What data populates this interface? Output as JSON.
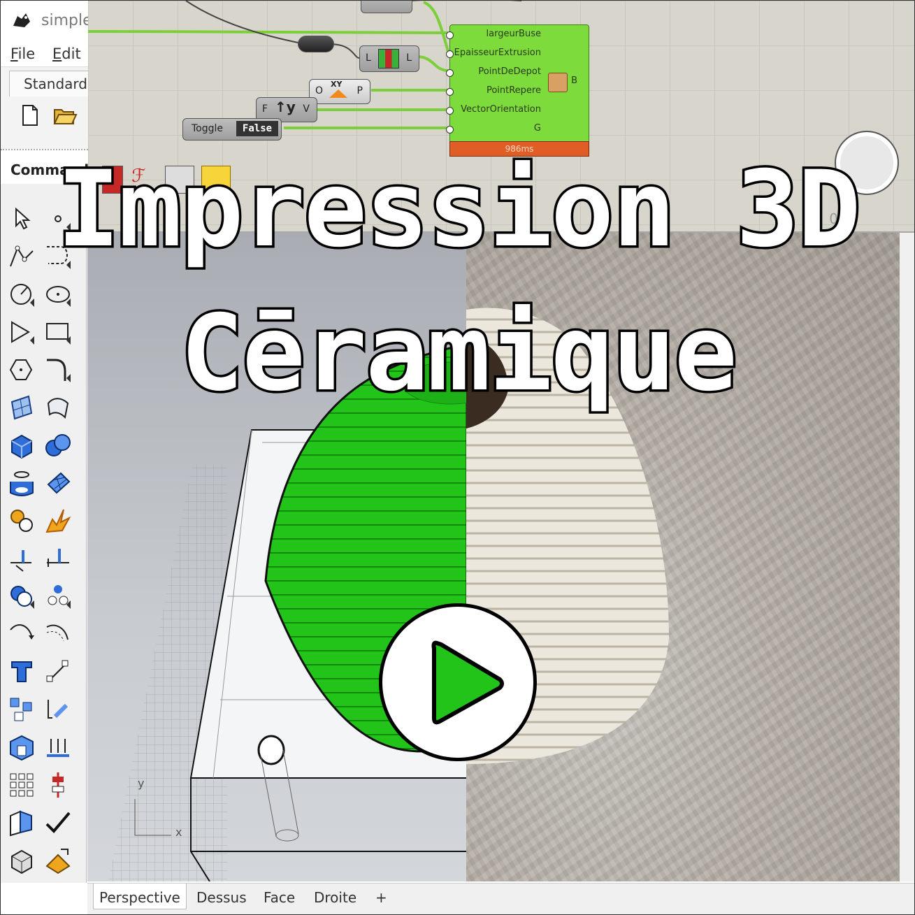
{
  "window": {
    "title": "simple"
  },
  "menu": {
    "file": "File",
    "edit": "Edit"
  },
  "toolbar": {
    "tab_label": "Standard"
  },
  "command": {
    "label": "Command"
  },
  "grasshopper": {
    "component_inputs": [
      "largeurBuse",
      "EpaisseurExtrusion",
      "PointDeDepot",
      "PointRepere",
      "VectorOrientation",
      "G"
    ],
    "component_output": "B",
    "timing": "986ms",
    "toggle_label": "Toggle",
    "toggle_value": "False",
    "vector_in": "F",
    "vector_out": "V",
    "vector_axis": "y",
    "xy_in": "O",
    "xy_label": "XY",
    "xy_out": "P",
    "merge_left": "L",
    "merge_right": "L",
    "zoom_readout": "0.0"
  },
  "viewport_axes": {
    "y": "y",
    "x": "x"
  },
  "view_tabs": [
    "Perspective",
    "Dessus",
    "Face",
    "Droite",
    "+"
  ],
  "overlay": {
    "line1": "Impression 3D",
    "line2": "Cēramique"
  },
  "colors": {
    "model_green": "#22c41a",
    "gh_component": "#7ddb3c",
    "timing_bar": "#e05d26",
    "ceramic": "#e8e2d6"
  }
}
